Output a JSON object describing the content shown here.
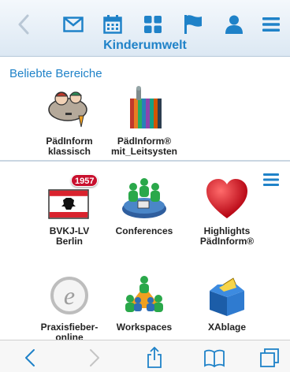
{
  "header": {
    "title": "Kinderumwelt",
    "icons": [
      "back-icon",
      "mail-icon",
      "calendar-icon",
      "grid-icon",
      "flag-icon",
      "user-icon",
      "menu-icon"
    ]
  },
  "favorites": {
    "title": "Beliebte Bereiche",
    "items": [
      {
        "label": "PädInform\nklassisch",
        "icon": "paedinform-classic-icon"
      },
      {
        "label": "PädInform®\nmit_Leitsysten",
        "icon": "books-icon"
      }
    ]
  },
  "apps": {
    "items": [
      {
        "label": "BVKJ-LV\nBerlin",
        "badge": "1957",
        "icon": "berlin-flag-icon"
      },
      {
        "label": "Conferences",
        "icon": "conference-icon"
      },
      {
        "label": "Highlights\nPädInform®",
        "icon": "heart-icon"
      },
      {
        "label": "Praxisfieber-\nonline",
        "icon": "e-logo-icon"
      },
      {
        "label": "Workspaces",
        "icon": "workspaces-icon"
      },
      {
        "label": "XAblage",
        "icon": "box-icon"
      }
    ]
  },
  "colors": {
    "accent": "#1f82c8",
    "badge": "#c8102e"
  }
}
